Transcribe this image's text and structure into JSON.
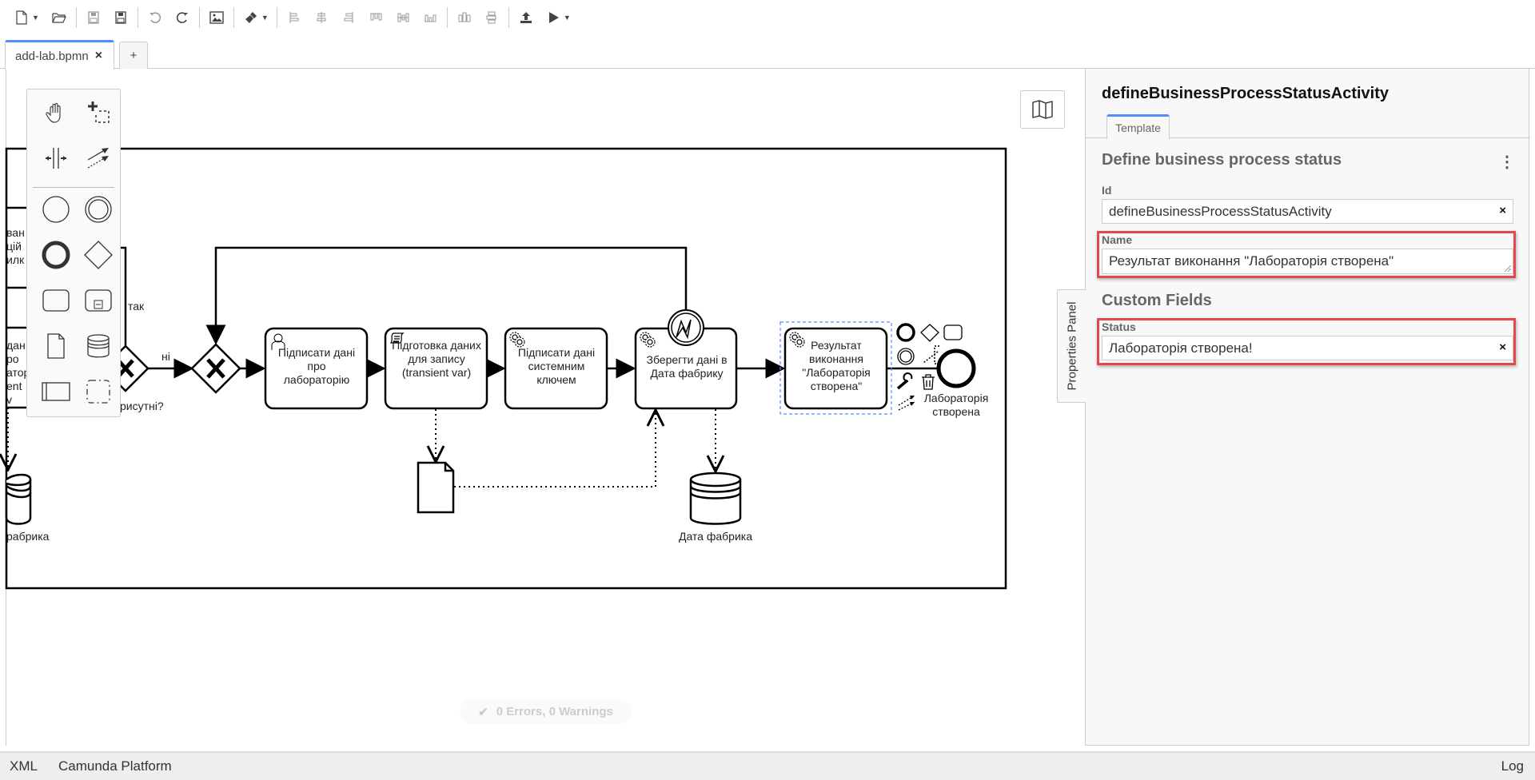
{
  "toolbar": {
    "buttons": [
      {
        "name": "new-file",
        "icon": "file-icon",
        "has_dropdown": true
      },
      {
        "name": "open-file",
        "icon": "folder-open-icon"
      },
      {
        "name": "save",
        "icon": "save-icon",
        "disabled": true
      },
      {
        "name": "save-as",
        "icon": "save-as-icon"
      },
      {
        "name": "undo",
        "icon": "undo-icon",
        "disabled": true
      },
      {
        "name": "redo",
        "icon": "redo-icon"
      },
      {
        "name": "export-image",
        "icon": "image-icon"
      },
      {
        "name": "color",
        "icon": "paintbrush-icon",
        "has_dropdown": true
      },
      {
        "name": "align-left",
        "icon": "align-left-icon",
        "disabled": true
      },
      {
        "name": "align-center",
        "icon": "align-center-icon",
        "disabled": true
      },
      {
        "name": "align-right",
        "icon": "align-right-icon",
        "disabled": true
      },
      {
        "name": "align-top",
        "icon": "align-top-icon",
        "disabled": true
      },
      {
        "name": "align-middle",
        "icon": "align-middle-icon",
        "disabled": true
      },
      {
        "name": "align-bottom",
        "icon": "align-bottom-icon",
        "disabled": true
      },
      {
        "name": "distribute-horizontal",
        "icon": "distribute-horizontal-icon",
        "disabled": true
      },
      {
        "name": "distribute-vertical",
        "icon": "distribute-vertical-icon",
        "disabled": true
      },
      {
        "name": "deploy",
        "icon": "deploy-icon"
      },
      {
        "name": "start-instance",
        "icon": "play-icon",
        "has_dropdown": true
      }
    ]
  },
  "tabs": [
    {
      "label": "add-lab.bpmn",
      "active": true,
      "close": "×"
    },
    {
      "label": "+"
    }
  ],
  "palette": {
    "tools": [
      "hand-tool",
      "lasso-tool",
      "space-tool",
      "global-connect-tool"
    ],
    "elements": [
      "start-event",
      "intermediate-event",
      "end-event",
      "gateway",
      "task",
      "subprocess",
      "data-object",
      "data-store",
      "participant",
      "group"
    ]
  },
  "diagram": {
    "cut_labels": [
      "ван",
      "цій",
      "илк",
      "дан",
      "ро",
      "атор",
      "ent v",
      "рабрика"
    ],
    "gateway_question_label": "рисутні?",
    "flow_yes": "так",
    "flow_no": "ні",
    "tasks": [
      {
        "type": "user",
        "icon": "user-icon",
        "label": "Підписати дані про лабораторію"
      },
      {
        "type": "script",
        "icon": "script-icon",
        "label": "Підготовка даних для запису (transient var)"
      },
      {
        "type": "service",
        "icon": "gear-icon",
        "label": "Підписати дані системним ключем"
      },
      {
        "type": "service",
        "icon": "gear-icon",
        "label": "Зберегти дані в Дата фабрику",
        "boundary_event": "error-event"
      },
      {
        "type": "service",
        "icon": "gear-icon",
        "label": "Результат виконання \"Лабораторія створена\"",
        "selected": true
      }
    ],
    "end_event_label": "Лабораторія створена",
    "data_store_label": "Дата фабрика"
  },
  "validation": {
    "text": "0 Errors, 0 Warnings"
  },
  "properties": {
    "toggle_label": "Properties Panel",
    "element_id_title": "defineBusinessProcessStatusActivity",
    "tab": "Template",
    "group_title": "Define business process status",
    "id_label": "Id",
    "id_value": "defineBusinessProcessStatusActivity",
    "name_label": "Name",
    "name_value": "Результат виконання \"Лабораторія створена\"",
    "custom_fields_title": "Custom Fields",
    "status_label": "Status",
    "status_value": "Лабораторія створена!",
    "clear_symbol": "×",
    "menu_symbol": "⋮"
  },
  "footer": {
    "xml": "XML",
    "platform": "Camunda Platform",
    "log": "Log"
  },
  "colors": {
    "accent": "#4d90fe",
    "highlight": "#e4474e",
    "selection": "#4d90fe"
  }
}
